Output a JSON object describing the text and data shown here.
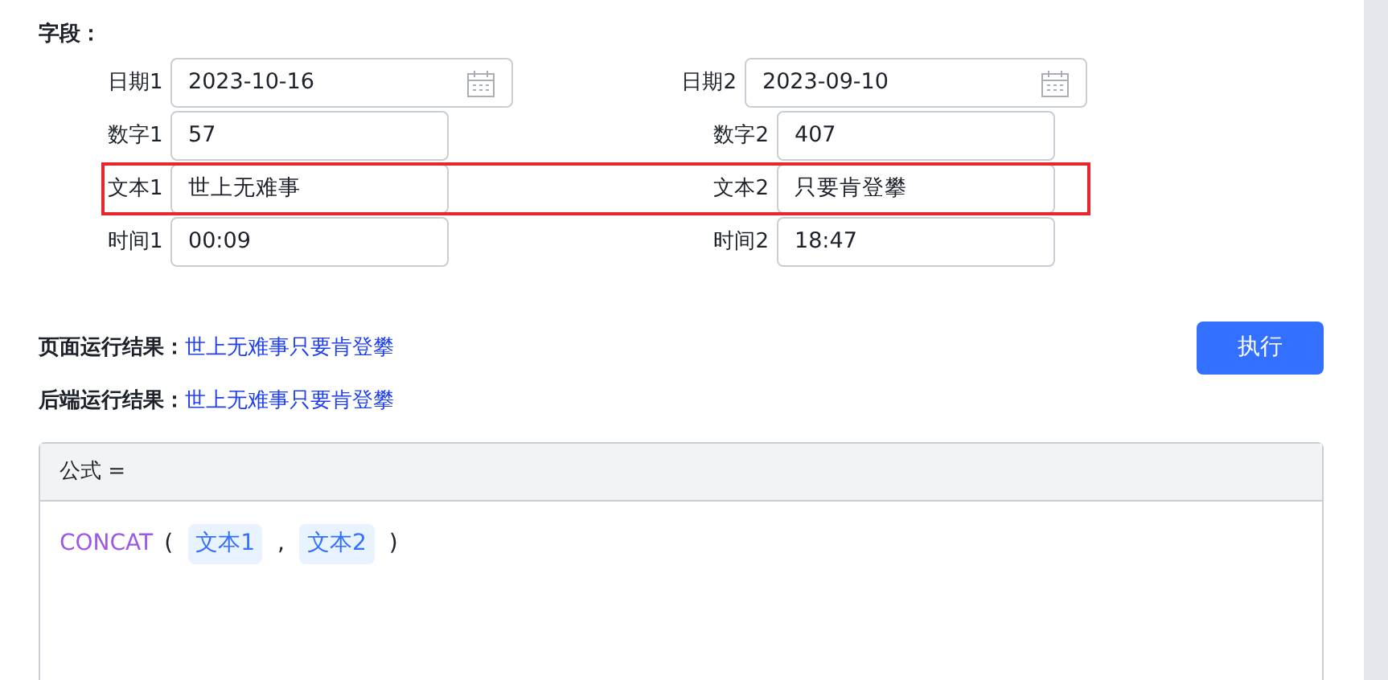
{
  "section_title": "字段：",
  "field_rows": [
    {
      "highlighted": false,
      "fields": [
        {
          "label": "日期1",
          "value": "2023-10-16",
          "kind": "date"
        },
        {
          "label": "日期2",
          "value": "2023-09-10",
          "kind": "date"
        }
      ]
    },
    {
      "highlighted": false,
      "fields": [
        {
          "label": "数字1",
          "value": "57",
          "kind": "text"
        },
        {
          "label": "数字2",
          "value": "407",
          "kind": "text"
        }
      ]
    },
    {
      "highlighted": true,
      "fields": [
        {
          "label": "文本1",
          "value": "世上无难事",
          "kind": "text"
        },
        {
          "label": "文本2",
          "value": "只要肯登攀",
          "kind": "text"
        }
      ]
    },
    {
      "highlighted": false,
      "fields": [
        {
          "label": "时间1",
          "value": "00:09",
          "kind": "text"
        },
        {
          "label": "时间2",
          "value": "18:47",
          "kind": "text"
        }
      ]
    }
  ],
  "results": [
    {
      "label": "页面运行结果：",
      "value": "世上无难事只要肯登攀"
    },
    {
      "label": "后端运行结果：",
      "value": "世上无难事只要肯登攀"
    }
  ],
  "run_button": "执行",
  "formula": {
    "header": "公式 =",
    "tokens": [
      {
        "kind": "function",
        "text": "CONCAT"
      },
      {
        "kind": "punct",
        "text": "("
      },
      {
        "kind": "field",
        "text": "文本1"
      },
      {
        "kind": "punct",
        "text": ","
      },
      {
        "kind": "field",
        "text": "文本2"
      },
      {
        "kind": "punct",
        "text": ")"
      }
    ]
  }
}
